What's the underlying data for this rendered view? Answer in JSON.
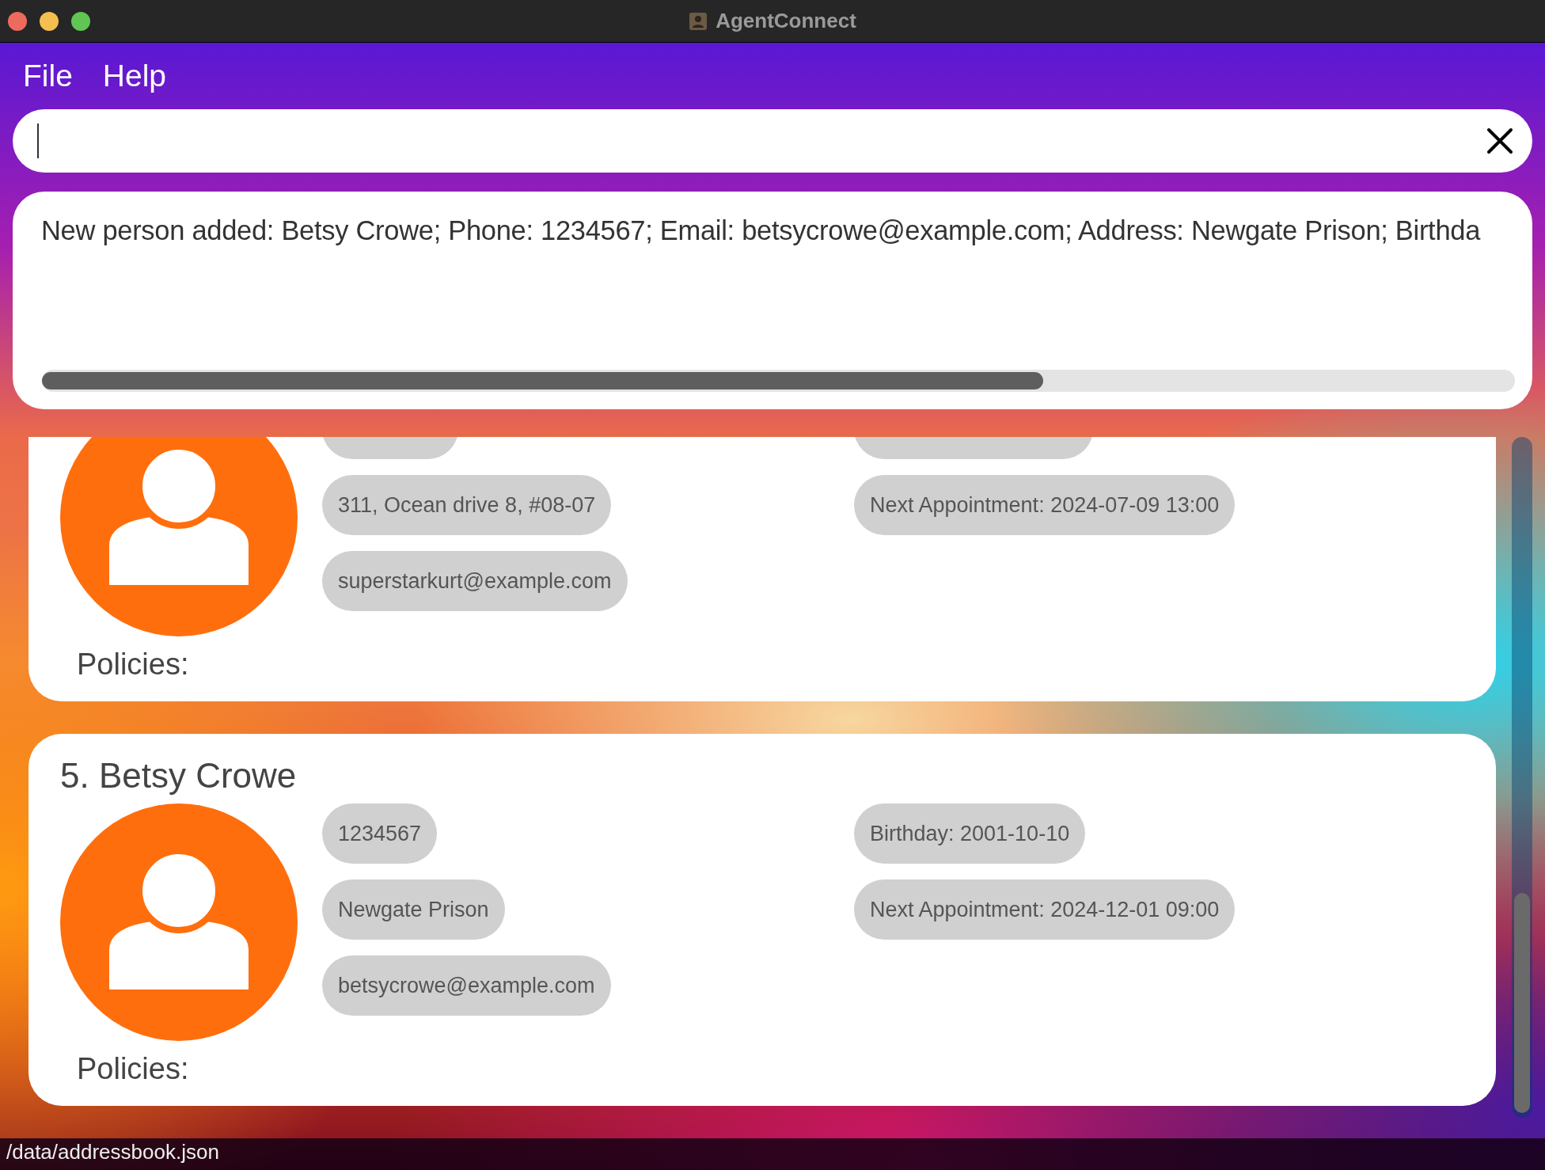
{
  "window": {
    "title": "AgentConnect"
  },
  "menu": [
    "File",
    "Help"
  ],
  "result": {
    "text": "New person added: Betsy Crowe; Phone: 1234567; Email: betsycrowe@example.com; Address: Newgate Prison; Birthda"
  },
  "persons": [
    {
      "left": [
        {
          "kind": "cut"
        },
        {
          "kind": "chip",
          "text": "311, Ocean drive 8, #08-07"
        },
        {
          "kind": "chip",
          "text": "superstarkurt@example.com"
        }
      ],
      "right": [
        {
          "kind": "cut"
        },
        {
          "kind": "chip",
          "text": "Next Appointment: 2024-07-09 13:00"
        }
      ],
      "policies_label": "Policies:"
    },
    {
      "name": "5. Betsy Crowe",
      "left": [
        {
          "kind": "chip",
          "text": "1234567"
        },
        {
          "kind": "chip",
          "text": "Newgate Prison"
        },
        {
          "kind": "chip",
          "text": "betsycrowe@example.com"
        }
      ],
      "right": [
        {
          "kind": "chip",
          "text": "Birthday: 2001-10-10"
        },
        {
          "kind": "chip",
          "text": "Next Appointment: 2024-12-01 09:00"
        }
      ],
      "policies_label": "Policies:"
    }
  ],
  "status_bar": {
    "path": "/data/addressbook.json"
  }
}
